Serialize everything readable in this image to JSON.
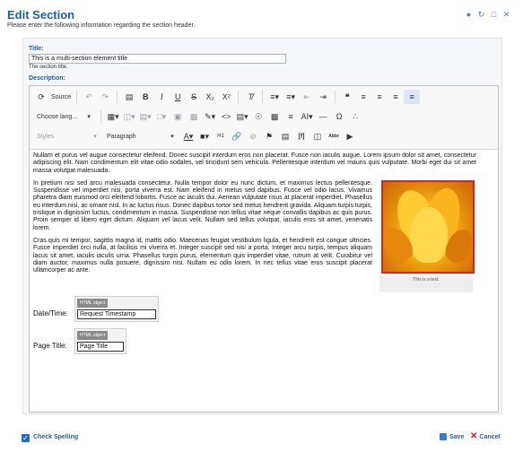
{
  "header": {
    "title": "Edit Section",
    "subtitle": "Please enter the following information regarding the section header."
  },
  "form": {
    "title_label": "Title:",
    "title_value": "This is a multi-section element title",
    "title_hint": "The section title.",
    "description_label": "Description:"
  },
  "toolbar": {
    "source_label": "Source",
    "language_label": "Choose lang...",
    "styles_label": "Styles",
    "format_label": "Paragraph",
    "abbr_label": "Abbr",
    "bracket_label": "[f]"
  },
  "content": {
    "para1": "Nullam et purus vel augue consectetur eleifend. Donec suscipit interdum eros non placerat. Fusce non iaculis augue. Lorem ipsum dolor sit amet, consectetur adipiscing elit. Nam condimentum elit vitae odio sodales, vel tincidunt sem vehicula. Pellentesque interdum vel mauris quis vulputate. Morbi eget dui sit amet massa volutpat malesuada.",
    "para2": "In pretium nisi sed arcu malesuada consectetur. Nulla tempor dolor eu nunc dictum, et maximus lectus pellentesque. Suspendisse vel imperdiet nisi, porta viverra est. Nam eleifend in metus sed dapibus. Fusce vel odio lacus. Vivamus pharetra diam euismod orci eleifend lobortis. Fusce ac iaculis dui. Aenean vulputate risus at placerat imperdiet. Phasellus eu interdum nisi, ac ornare nisl. In ac luctus risus. Donec dapibus tortor sed metus hendrerit gravida. Aliquam turpis turpis, tristique in dignissim luctus, condimentum in massa. Suspendisse non tellus vitae neque convallis dapibus ac quis purus. Proin semper id libero eget dictum. Aliquam vel lacus velit. Nullam sed tellus volutpat, iaculis eros sit amet, venenatis lorem.",
    "para3": "Cras quis mi tempor, sagittis magna id, mattis odio. Maecenas feugiat vestibulum ligula, et hendrerit est congue ultricies. Fusce imperdiet orci nulla, at facilisis mi viverra et. Integer suscipit sed nisi a porta. Integer arcu turpis, tempus aliquam lacus sit amet, iaculis iaculis urna. Phasellus turpis purus, elementum quis imperdiet vitae, rutrum at velit. Curabitur vel diam auctor, maximus nulla posuere, dignissim nisi. Nullam eu odio lorem. In nec tellus vitae eros suscipit placerat ullamcorper ac ante.",
    "image_caption": "This is a test.",
    "html_object_tag": "HTML object",
    "datetime_label": "Date/Time:",
    "datetime_value": "Request Timestamp",
    "pagetitle_label": "Page Title:",
    "pagetitle_value": "Page Title"
  },
  "footer": {
    "check_spelling": "Check Spelling",
    "save": "Save",
    "cancel": "Cancel"
  },
  "colors": {
    "accent": "#1f5fa8",
    "image_border": "#e0221e",
    "cancel_icon": "#d62020"
  }
}
